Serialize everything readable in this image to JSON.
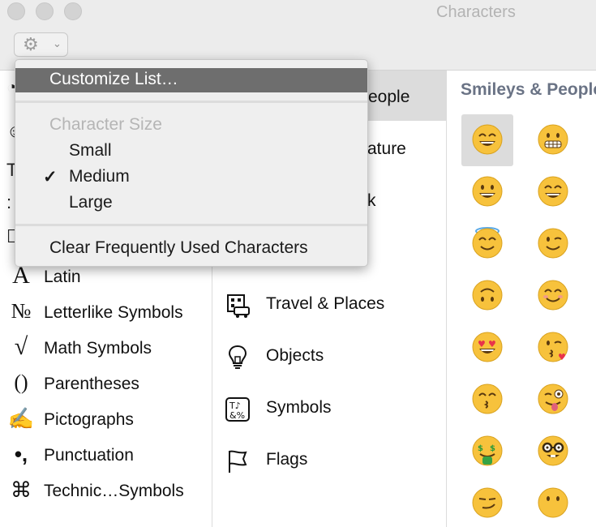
{
  "window": {
    "title": "Characters"
  },
  "toolbar": {
    "gear_icon": "gear-icon",
    "chevron_icon": "chevron-down-icon"
  },
  "menu": {
    "customize": "Customize List…",
    "size_header": "Character Size",
    "sizes": [
      {
        "label": "Small",
        "checked": false
      },
      {
        "label": "Medium",
        "checked": true
      },
      {
        "label": "Large",
        "checked": false
      }
    ],
    "check_mark": "✓",
    "clear": "Clear Frequently Used Characters"
  },
  "sidebar": {
    "items": [
      {
        "icon": "A",
        "label": "Latin"
      },
      {
        "icon": "№",
        "label": "Letterlike Symbols"
      },
      {
        "icon": "√",
        "label": "Math Symbols"
      },
      {
        "icon": "()",
        "label": "Parentheses"
      },
      {
        "icon": "✍",
        "label": "Pictographs"
      },
      {
        "icon": "•,",
        "label": "Punctuation"
      },
      {
        "icon": "⌘",
        "label": "Technic…Symbols"
      }
    ]
  },
  "categories": {
    "selected_partial": "eople",
    "nature_partial": "ature",
    "food_partial": "k",
    "items": [
      {
        "icon": "building-car-icon",
        "label": "Travel & Places"
      },
      {
        "icon": "lightbulb-icon",
        "label": "Objects"
      },
      {
        "icon": "symbols-icon",
        "label": "Symbols"
      },
      {
        "icon": "flag-icon",
        "label": "Flags"
      }
    ]
  },
  "emoji_panel": {
    "section_title": "Smileys & People",
    "emojis": [
      "grinning-face",
      "grimacing-face",
      "smiling-face-open-mouth",
      "smiling-face-smiling-eyes",
      "smiling-face-halo",
      "winking-face",
      "upside-down-face",
      "smiling-face-blush",
      "heart-eyes-face",
      "kissing-face-heart",
      "kissing-closed-eyes-face",
      "winking-tongue-face",
      "money-mouth-face",
      "nerd-face",
      "smirking-face",
      "face-no-mouth"
    ]
  },
  "colors": {
    "highlight": "#6e6e6e",
    "section_title": "#6a7385",
    "emoji_yellow": "#f7c23c"
  }
}
